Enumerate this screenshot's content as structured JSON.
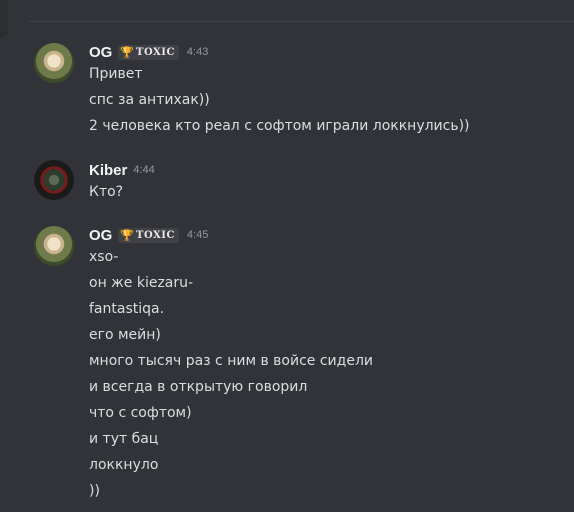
{
  "messages": [
    {
      "username": "OG",
      "tag": "TOXIC",
      "tag_icon": "trophy-icon",
      "time": "4:43",
      "lines": [
        "Привет",
        "спс за антихак))",
        "2 человека кто реал с софтом играли локкнулись))"
      ]
    },
    {
      "username": "Kiber",
      "time": "4:44",
      "lines": [
        "Кто?"
      ]
    },
    {
      "username": "OG",
      "tag": "TOXIC",
      "tag_icon": "trophy-icon",
      "time": "4:45",
      "lines": [
        "xso-",
        "он же kiezaru-",
        "fantastiqa.",
        "его мейн)",
        "много тысяч раз с ним в войсе сидели",
        "и всегда в открытую говорил",
        "что с софтом)",
        "и тут бац",
        "локкнуло",
        "))"
      ]
    }
  ],
  "colors": {
    "background": "#313338",
    "username": "#f2f3f5",
    "text": "#dbdee1",
    "timestamp": "#949ba4",
    "tag_icon": "#4ae07a"
  }
}
